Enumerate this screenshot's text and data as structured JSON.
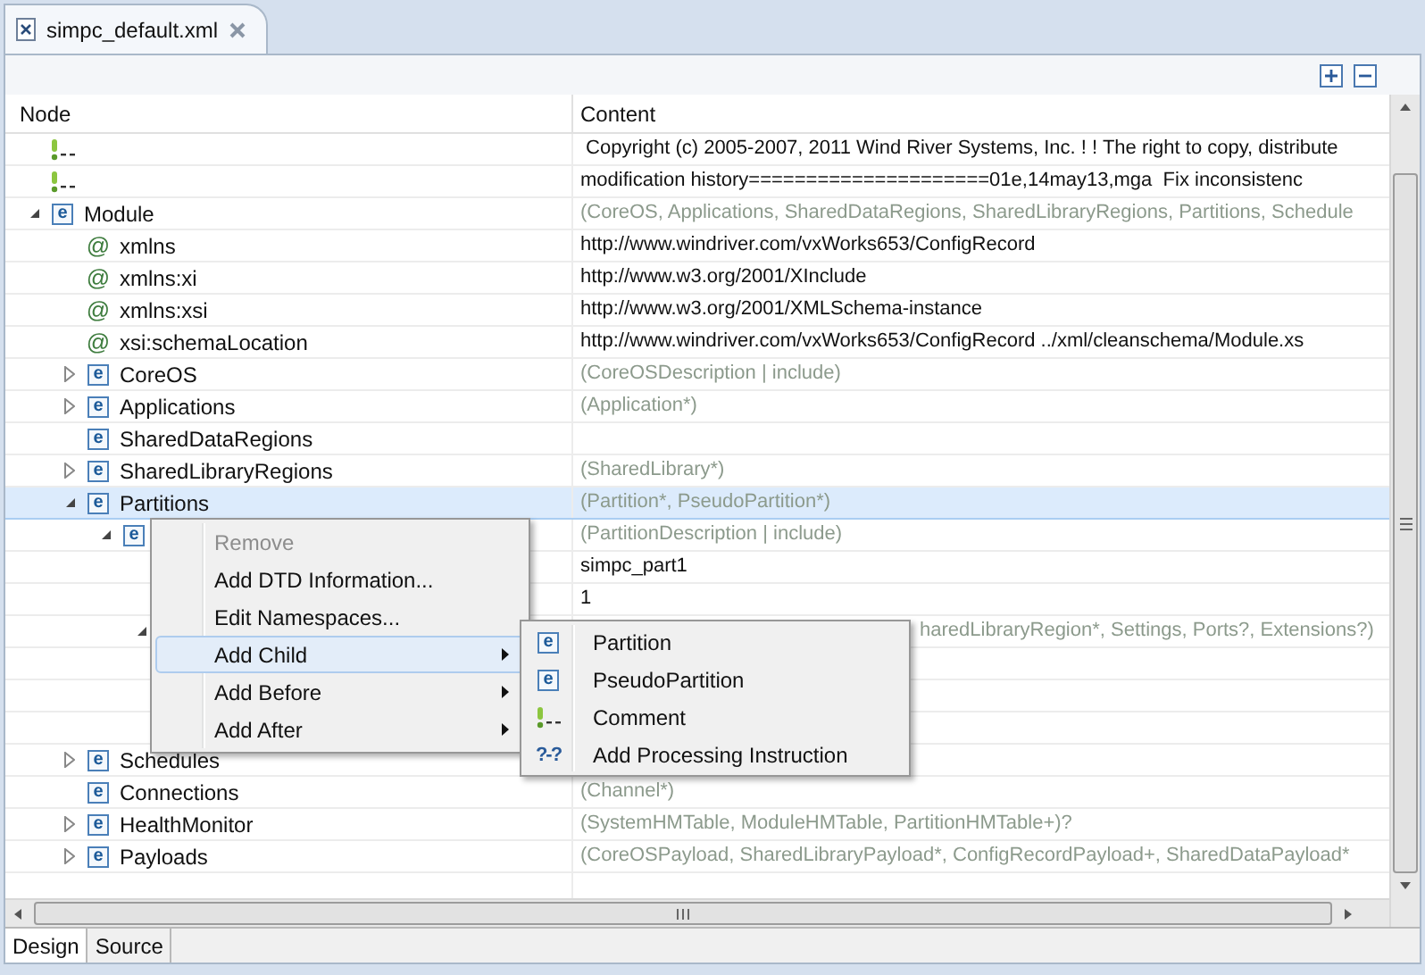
{
  "editor_tab": {
    "title": "simpc_default.xml",
    "selected": true
  },
  "table": {
    "columns": [
      "Node",
      "Content"
    ],
    "rows": [
      {
        "kind": "comment",
        "selected": false,
        "content": " Copyright (c) 2005-2007, 2011 Wind River Systems, Inc. ! ! The right to copy, distribute",
        "hint": false
      },
      {
        "kind": "comment",
        "selected": false,
        "content": "modification history=====================01e,14may13,mga  Fix inconsistenc",
        "hint": false
      },
      {
        "kind": "element",
        "icon": "e",
        "name": "Module",
        "expanded": true,
        "selected": false,
        "content": "(CoreOS, Applications, SharedDataRegions, SharedLibraryRegions, Partitions, Schedule",
        "hint": true,
        "children": [
          {
            "kind": "attribute",
            "icon": "@",
            "name": "xmlns",
            "selected": false,
            "content": "http://www.windriver.com/vxWorks653/ConfigRecord",
            "hint": false
          },
          {
            "kind": "attribute",
            "icon": "@",
            "name": "xmlns:xi",
            "selected": false,
            "content": "http://www.w3.org/2001/XInclude",
            "hint": false
          },
          {
            "kind": "attribute",
            "icon": "@",
            "name": "xmlns:xsi",
            "selected": false,
            "content": "http://www.w3.org/2001/XMLSchema-instance",
            "hint": false
          },
          {
            "kind": "attribute",
            "icon": "@",
            "name": "xsi:schemaLocation",
            "selected": false,
            "content": "http://www.windriver.com/vxWorks653/ConfigRecord ../xml/cleanschema/Module.xs",
            "hint": false
          },
          {
            "kind": "element",
            "icon": "e",
            "name": "CoreOS",
            "expanded": false,
            "selected": false,
            "content": "(CoreOSDescription | include)",
            "hint": true
          },
          {
            "kind": "element",
            "icon": "e",
            "name": "Applications",
            "expanded": false,
            "selected": false,
            "content": "(Application*)",
            "hint": true
          },
          {
            "kind": "element",
            "icon": "e",
            "name": "SharedDataRegions",
            "selected": false
          },
          {
            "kind": "element",
            "icon": "e",
            "name": "SharedLibraryRegions",
            "expanded": false,
            "selected": false,
            "content": "(SharedLibrary*)",
            "hint": true
          },
          {
            "kind": "element",
            "icon": "e",
            "name": "Partitions",
            "expanded": true,
            "selected": true,
            "content": "(Partition*, PseudoPartition*)",
            "hint": true,
            "children": [
              {
                "kind": "element",
                "icon": "e",
                "expanded": true,
                "selected": false,
                "content": "(PartitionDescription | include)",
                "hint": true,
                "children": [
                  {
                    "selected": false,
                    "content": "simpc_part1",
                    "hint": false
                  },
                  {
                    "selected": false,
                    "content": "1",
                    "hint": false
                  },
                  {
                    "expanded": true,
                    "selected": false,
                    "content": "haredLibraryRegion*, Settings, Ports?, Extensions?)",
                    "hint": true,
                    "content_covered": true,
                    "children": [
                      {
                        "selected": false
                      },
                      {
                        "selected": false
                      },
                      {
                        "selected": false
                      }
                    ]
                  }
                ]
              }
            ]
          },
          {
            "kind": "element",
            "icon": "e",
            "name": "Schedules",
            "expanded": false,
            "selected": false
          },
          {
            "kind": "element",
            "icon": "e",
            "name": "Connections",
            "selected": false,
            "content": "(Channel*)",
            "hint": true
          },
          {
            "kind": "element",
            "icon": "e",
            "name": "HealthMonitor",
            "expanded": false,
            "selected": false,
            "content": "(SystemHMTable, ModuleHMTable, PartitionHMTable+)?",
            "hint": true
          },
          {
            "kind": "element",
            "icon": "e",
            "name": "Payloads",
            "expanded": false,
            "selected": false,
            "content": "(CoreOSPayload, SharedLibraryPayload*, ConfigRecordPayload+, SharedDataPayload*",
            "hint": true
          }
        ]
      }
    ]
  },
  "context_menu": {
    "items": [
      {
        "label": "Remove",
        "disabled": true,
        "selected": false,
        "has_submenu": false
      },
      {
        "label": "Add DTD Information...",
        "disabled": false,
        "selected": false,
        "has_submenu": false
      },
      {
        "label": "Edit Namespaces...",
        "disabled": false,
        "selected": false,
        "has_submenu": false
      },
      {
        "label": "Add Child",
        "disabled": false,
        "selected": true,
        "has_submenu": true
      },
      {
        "label": "Add Before",
        "disabled": false,
        "selected": false,
        "has_submenu": true
      },
      {
        "label": "Add After",
        "disabled": false,
        "selected": false,
        "has_submenu": true
      }
    ]
  },
  "submenu": {
    "items": [
      {
        "kind": "element",
        "icon": "e",
        "label": "Partition"
      },
      {
        "kind": "element",
        "icon": "e",
        "label": "PseudoPartition"
      },
      {
        "kind": "comment",
        "label": "Comment"
      },
      {
        "kind": "instruction",
        "icon": "?-?",
        "label": "Add Processing Instruction"
      }
    ]
  },
  "bottom_tabs": [
    {
      "label": "Design",
      "selected": true
    },
    {
      "label": "Source",
      "selected": false
    }
  ]
}
